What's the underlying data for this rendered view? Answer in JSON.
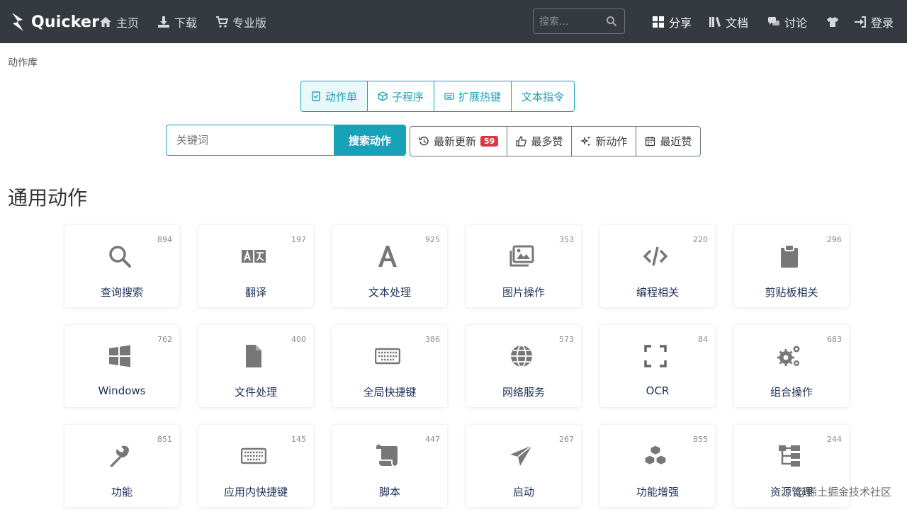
{
  "navbar": {
    "brand": "Quicker",
    "links": [
      {
        "label": "主页",
        "icon": "home-icon"
      },
      {
        "label": "下载",
        "icon": "download-icon"
      },
      {
        "label": "专业版",
        "icon": "cart-icon"
      }
    ],
    "search_placeholder": "搜索...",
    "right_links": [
      {
        "label": "分享",
        "icon": "grid-icon"
      },
      {
        "label": "文档",
        "icon": "books-icon"
      },
      {
        "label": "讨论",
        "icon": "comments-icon"
      },
      {
        "label": "",
        "icon": "tshirt-icon"
      },
      {
        "label": "登录",
        "icon": "sign-in-icon"
      }
    ]
  },
  "breadcrumb": "动作库",
  "type_tabs": [
    "动作单",
    "子程序",
    "扩展热键",
    "文本指令"
  ],
  "keyword": {
    "placeholder": "关键词",
    "button": "搜索动作"
  },
  "sort_tabs": [
    {
      "label": "最新更新",
      "badge": "59"
    },
    {
      "label": "最多赞"
    },
    {
      "label": "新动作"
    },
    {
      "label": "最近赞"
    }
  ],
  "section_title": "通用动作",
  "categories": [
    {
      "label": "查询搜索",
      "count": "894",
      "icon": "search-icon"
    },
    {
      "label": "翻译",
      "count": "197",
      "icon": "translate-icon"
    },
    {
      "label": "文本处理",
      "count": "925",
      "icon": "font-icon"
    },
    {
      "label": "图片操作",
      "count": "353",
      "icon": "images-icon"
    },
    {
      "label": "编程相关",
      "count": "220",
      "icon": "code-icon"
    },
    {
      "label": "剪贴板相关",
      "count": "296",
      "icon": "clipboard-icon"
    },
    {
      "label": "Windows",
      "count": "762",
      "icon": "windows-icon"
    },
    {
      "label": "文件处理",
      "count": "400",
      "icon": "file-icon"
    },
    {
      "label": "全局快捷键",
      "count": "386",
      "icon": "keyboard-icon"
    },
    {
      "label": "网络服务",
      "count": "573",
      "icon": "globe-icon"
    },
    {
      "label": "OCR",
      "count": "84",
      "icon": "scan-frame-icon"
    },
    {
      "label": "组合操作",
      "count": "683",
      "icon": "cogs-icon"
    },
    {
      "label": "功能",
      "count": "851",
      "icon": "wrench-icon"
    },
    {
      "label": "应用内快捷键",
      "count": "145",
      "icon": "keyboard-icon"
    },
    {
      "label": "脚本",
      "count": "447",
      "icon": "scroll-icon"
    },
    {
      "label": "启动",
      "count": "267",
      "icon": "paper-plane-icon"
    },
    {
      "label": "功能增强",
      "count": "855",
      "icon": "cubes-icon"
    },
    {
      "label": "资源管理",
      "count": "244",
      "icon": "sitemap-icon"
    }
  ],
  "watermark": "@稀土掘金技术社区"
}
